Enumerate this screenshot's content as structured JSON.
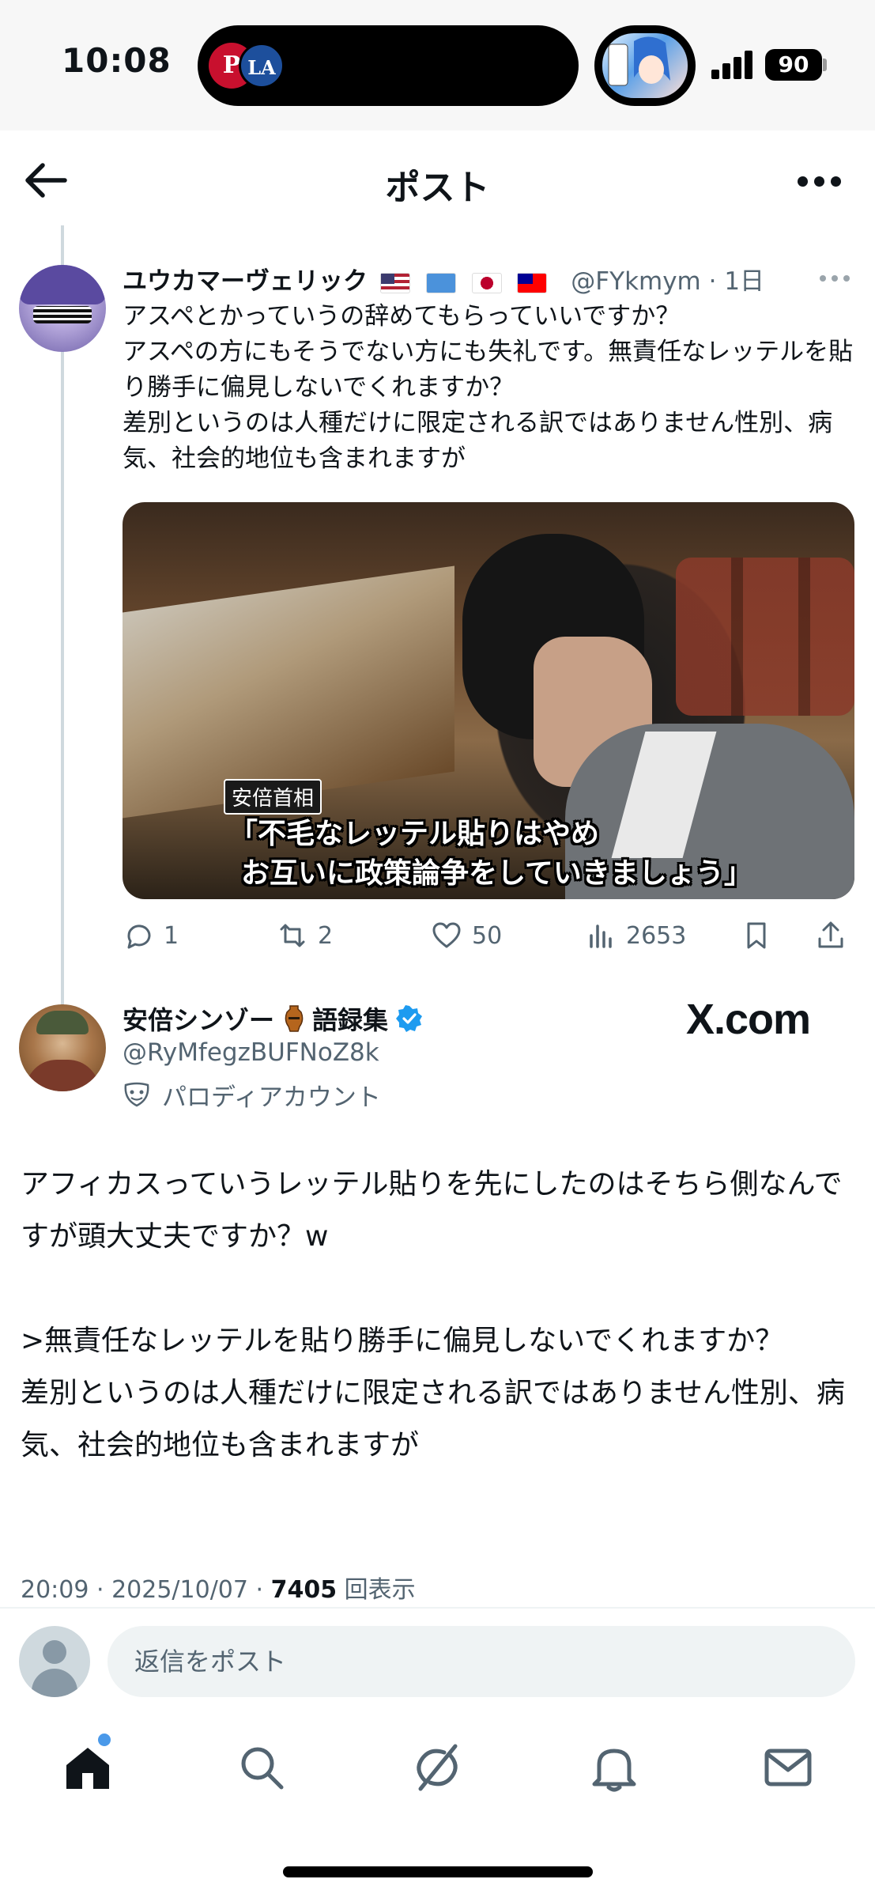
{
  "status_bar": {
    "time": "10:08",
    "team_logo_left": "P",
    "team_logo_right": "LA",
    "battery": "90",
    "live_activity_icon": "anime-character-thumbnail"
  },
  "header": {
    "title": "ポスト",
    "back_icon": "arrow-left-icon",
    "more_icon": "more-horizontal-icon"
  },
  "parent_post": {
    "display_name": "ユウカマーヴェリック",
    "flags": [
      "us-flag",
      "un-flag",
      "japan-flag",
      "taiwan-flag"
    ],
    "handle": "@FYkmym",
    "time": "· 1日",
    "text": "アスペとかっていうの辞めてもらっていいですか？\nアスペの方にもそうでない方にも失礼です。無責任なレッテルを貼り勝手に偏見しないでくれますか？\n差別というのは人種だけに限定される訳ではありません性別、病気、社会的地位も含まれますが",
    "media": {
      "caption_tag": "安倍首相",
      "caption_line1": "「不毛なレッテル貼りはやめ",
      "caption_line2": "お互いに政策論争をしていきましょう」"
    },
    "stats": {
      "replies": "1",
      "reposts": "2",
      "likes": "50",
      "views": "2653"
    }
  },
  "main_post": {
    "display_name": "安倍シンゾー",
    "name_suffix": "語録集",
    "handle": "@RyMfegzBUFNoZ8k",
    "parody_label": "パロディアカウント",
    "watermark": "X.com",
    "text": "アフィカスっていうレッテル貼りを先にしたのはそちら側なんですが頭大丈夫ですか？w\n\n>無責任なレッテルを貼り勝手に偏見しないでくれますか？\n差別というのは人種だけに限定される訳ではありません性別、病気、社会的地位も含まれますが",
    "timestamp": "20:09 · 2025/10/07 · ",
    "view_count": "7405",
    "view_label": "回表示"
  },
  "reply_bar": {
    "placeholder": "返信をポスト"
  },
  "tab_bar": {
    "items": [
      "home-icon",
      "search-icon",
      "grok-icon",
      "notifications-icon",
      "messages-icon"
    ]
  },
  "colors": {
    "accent": "#1d9bf0",
    "text_primary": "#0f1419",
    "text_secondary": "#536471",
    "divider": "#eff3f4"
  }
}
